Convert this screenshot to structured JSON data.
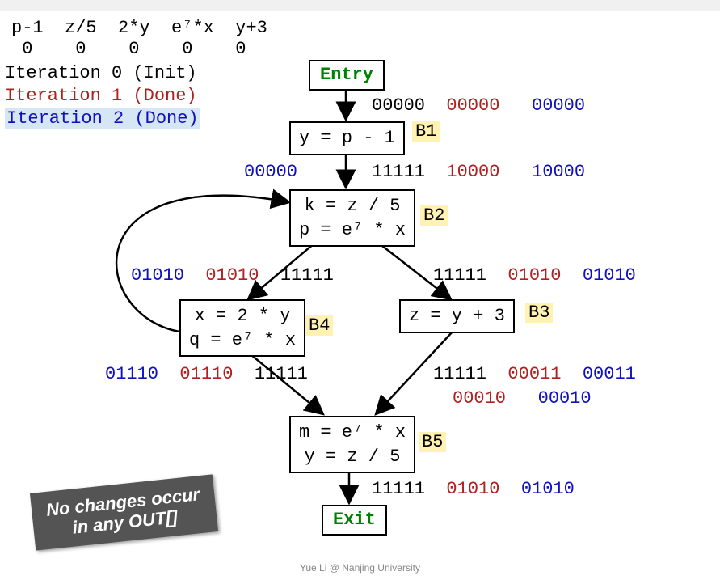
{
  "header": {
    "cols": [
      "p-1",
      "z/5",
      "2*y",
      "e⁷*x",
      "y+3"
    ],
    "vals": [
      "0",
      "0",
      "0",
      "0",
      "0"
    ]
  },
  "iterations": {
    "i0": "Iteration 0 (Init)",
    "i1": "Iteration 1 (Done)",
    "i2": "Iteration 2 (Done)"
  },
  "nodes": {
    "entry": "Entry",
    "exit": "Exit",
    "b1": {
      "label": "B1",
      "line1": "y = p - 1"
    },
    "b2": {
      "label": "B2",
      "line1": "k = z / 5",
      "line2": "p = e⁷ * x"
    },
    "b3": {
      "label": "B3",
      "line1": "z = y + 3"
    },
    "b4": {
      "label": "B4",
      "line1": "x = 2 * y",
      "line2": "q = e⁷ * x"
    },
    "b5": {
      "label": "B5",
      "line1": "m = e⁷ * x",
      "line2": "y = z / 5"
    }
  },
  "bits": {
    "entry_out_k": "00000",
    "entry_out_r": "00000",
    "entry_out_b": "00000",
    "b1_out_k": "11111",
    "b1_out_r": "10000",
    "b1_out_b": "10000",
    "b2_in_b": "00000",
    "b2_out_r_k": "11111",
    "b2_out_r_r": "01010",
    "b2_out_r_b": "01010",
    "b2_out_l_b": "01010",
    "b2_out_l_r": "01010",
    "b2_out_l_k": "11111",
    "b4_out_b": "01110",
    "b4_out_r": "01110",
    "b4_out_k": "11111",
    "b3_out_k": "11111",
    "b3_out_r": "00011",
    "b3_out_b": "00011",
    "b5_in_r": "00010",
    "b5_in_b": "00010",
    "b5_out_k": "11111",
    "b5_out_r": "01010",
    "b5_out_b": "01010"
  },
  "note": {
    "l1": "No changes occur",
    "l2": "in any OUT[]"
  },
  "footer": "Yue Li @ Nanjing University"
}
